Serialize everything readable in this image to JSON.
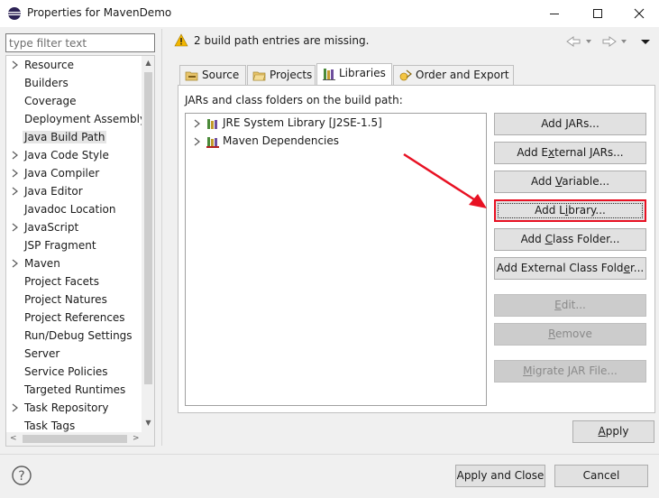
{
  "window": {
    "title": "Properties for MavenDemo"
  },
  "filter": {
    "placeholder": "type filter text"
  },
  "tree": {
    "items": [
      {
        "label": "Resource",
        "expandable": true
      },
      {
        "label": "Builders",
        "expandable": false
      },
      {
        "label": "Coverage",
        "expandable": false
      },
      {
        "label": "Deployment Assembly",
        "expandable": false
      },
      {
        "label": "Java Build Path",
        "expandable": false,
        "selected": true
      },
      {
        "label": "Java Code Style",
        "expandable": true
      },
      {
        "label": "Java Compiler",
        "expandable": true
      },
      {
        "label": "Java Editor",
        "expandable": true
      },
      {
        "label": "Javadoc Location",
        "expandable": false
      },
      {
        "label": "JavaScript",
        "expandable": true
      },
      {
        "label": "JSP Fragment",
        "expandable": false
      },
      {
        "label": "Maven",
        "expandable": true
      },
      {
        "label": "Project Facets",
        "expandable": false
      },
      {
        "label": "Project Natures",
        "expandable": false
      },
      {
        "label": "Project References",
        "expandable": false
      },
      {
        "label": "Run/Debug Settings",
        "expandable": false
      },
      {
        "label": "Server",
        "expandable": false
      },
      {
        "label": "Service Policies",
        "expandable": false
      },
      {
        "label": "Targeted Runtimes",
        "expandable": false
      },
      {
        "label": "Task Repository",
        "expandable": true
      },
      {
        "label": "Task Tags",
        "expandable": false
      }
    ]
  },
  "message": {
    "text": "2 build path entries are missing."
  },
  "tabs": [
    {
      "label": "Source",
      "icon": "source-folder-icon"
    },
    {
      "label": "Projects",
      "icon": "projects-icon"
    },
    {
      "label": "Libraries",
      "icon": "libraries-icon",
      "active": true
    },
    {
      "label": "Order and Export",
      "icon": "order-export-icon"
    }
  ],
  "libraries": {
    "section_label": "JARs and class folders on the build path:",
    "entries": [
      {
        "label": "JRE System Library [J2SE-1.5]"
      },
      {
        "label": "Maven Dependencies"
      }
    ]
  },
  "buttons": {
    "add_jars": {
      "pre": "Add ",
      "mn": "J",
      "post": "ARs..."
    },
    "add_external_jars": {
      "pre": "Add E",
      "mn": "x",
      "post": "ternal JARs..."
    },
    "add_variable": {
      "pre": "Add ",
      "mn": "V",
      "post": "ariable..."
    },
    "add_library": {
      "pre": "Add L",
      "mn": "i",
      "post": "brary..."
    },
    "add_class_folder": {
      "pre": "Add ",
      "mn": "C",
      "post": "lass Folder..."
    },
    "add_external_class_folder": {
      "pre": "Add External Class Fold",
      "mn": "e",
      "post": "r..."
    },
    "edit": {
      "pre": "",
      "mn": "E",
      "post": "dit..."
    },
    "remove": {
      "pre": "",
      "mn": "R",
      "post": "emove"
    },
    "migrate_jar": {
      "pre": "",
      "mn": "M",
      "post": "igrate JAR File..."
    },
    "apply": {
      "pre": "",
      "mn": "A",
      "post": "pply"
    }
  },
  "footer": {
    "apply_and_close": "Apply and Close",
    "cancel": "Cancel"
  },
  "colors": {
    "highlight": "#e81123",
    "warning": "#f2b600",
    "selection": "#e5e5e5"
  }
}
